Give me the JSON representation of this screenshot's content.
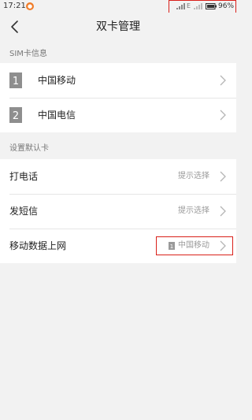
{
  "status_bar": {
    "time": "17:21",
    "app_icon_glyph": "●",
    "network_label": "E",
    "battery_text": "96%",
    "highlight_color": "#d9201a"
  },
  "header": {
    "title": "双卡管理",
    "back_icon": "chevron-left-icon"
  },
  "sim_section": {
    "header": "SIM卡信息",
    "items": [
      {
        "label": "中国移动",
        "badge": "1"
      },
      {
        "label": "中国电信",
        "badge": "2"
      }
    ]
  },
  "default_section": {
    "header": "设置默认卡",
    "items": [
      {
        "label": "打电话",
        "value": "提示选择"
      },
      {
        "label": "发短信",
        "value": "提示选择"
      },
      {
        "label": "移动数据上网",
        "value": "中国移动",
        "sim_badge": "1"
      }
    ]
  }
}
